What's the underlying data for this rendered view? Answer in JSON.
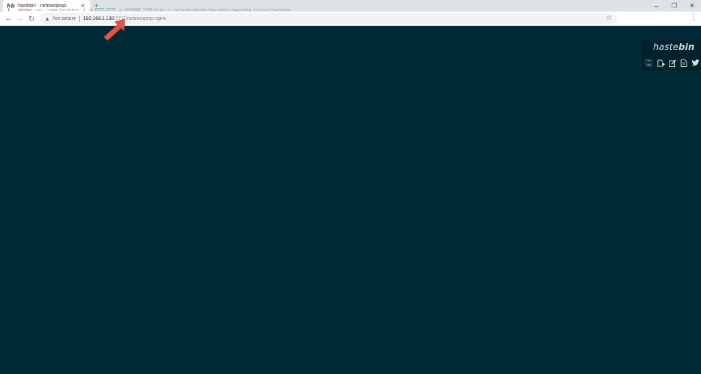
{
  "browser": {
    "tab": {
      "favicon_text": "hb",
      "title": "hastebin - netewoqeqo",
      "close": "✕"
    },
    "new_tab": "+",
    "window_controls": {
      "minimize": "–",
      "restore": "❐",
      "close": "✕"
    },
    "nav": {
      "back": "←",
      "forward": "→",
      "reload": "↻"
    },
    "security_label": "Not secure",
    "url": {
      "host": "192.168.1.130",
      "port": ":7777",
      "path": "/netewoqeqo.nginx"
    },
    "bookmark_star": "☆",
    "menu": "⋮"
  },
  "editor": {
    "line_number": "1",
    "tokens": {
      "cmd": "docker",
      "part1": " run --name hastebin -d -p ",
      "port": "7777:7777",
      "part2": " -e STORAGE_TYPE=file -v /volume1/docker/hastebin:/app/data rlister/hastebin"
    }
  },
  "hastebin": {
    "logo_thin": "haste",
    "logo_bold": "bin",
    "icons": [
      "save-icon",
      "new-icon",
      "edit-icon",
      "raw-icon",
      "twitter-icon"
    ]
  },
  "annotation": {
    "arrow_color": "#e8533f"
  }
}
